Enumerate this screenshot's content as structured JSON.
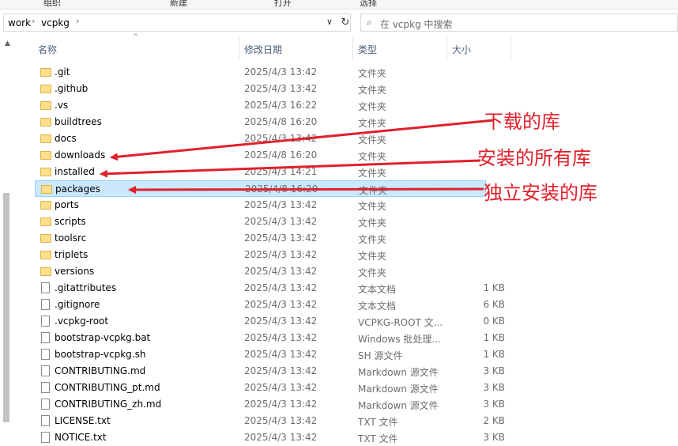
{
  "toolbar_labels": [
    "组织",
    "新建",
    "打开",
    "选择"
  ],
  "address": {
    "crumbs": [
      "work",
      "vcpkg"
    ]
  },
  "search": {
    "placeholder": "在 vcpkg 中搜索"
  },
  "columns": {
    "name": "名称",
    "date": "修改日期",
    "type": "类型",
    "size": "大小"
  },
  "files": [
    {
      "name": ".git",
      "date": "2025/4/3 13:42",
      "type": "文件夹",
      "size": "",
      "icon": "folder-icon"
    },
    {
      "name": ".github",
      "date": "2025/4/3 13:42",
      "type": "文件夹",
      "size": "",
      "icon": "folder-icon"
    },
    {
      "name": ".vs",
      "date": "2025/4/3 16:22",
      "type": "文件夹",
      "size": "",
      "icon": "folder-icon"
    },
    {
      "name": "buildtrees",
      "date": "2025/4/8 16:20",
      "type": "文件夹",
      "size": "",
      "icon": "folder-icon"
    },
    {
      "name": "docs",
      "date": "2025/4/3 13:42",
      "type": "文件夹",
      "size": "",
      "icon": "folder-icon"
    },
    {
      "name": "downloads",
      "date": "2025/4/8 16:20",
      "type": "文件夹",
      "size": "",
      "icon": "folder-icon"
    },
    {
      "name": "installed",
      "date": "2025/4/3 14:21",
      "type": "文件夹",
      "size": "",
      "icon": "folder-icon"
    },
    {
      "name": "packages",
      "date": "2025/4/8 16:20",
      "type": "文件夹",
      "size": "",
      "icon": "folder-icon",
      "selected": true
    },
    {
      "name": "ports",
      "date": "2025/4/3 13:42",
      "type": "文件夹",
      "size": "",
      "icon": "folder-icon"
    },
    {
      "name": "scripts",
      "date": "2025/4/3 13:42",
      "type": "文件夹",
      "size": "",
      "icon": "folder-icon"
    },
    {
      "name": "toolsrc",
      "date": "2025/4/3 13:42",
      "type": "文件夹",
      "size": "",
      "icon": "folder-icon"
    },
    {
      "name": "triplets",
      "date": "2025/4/3 13:42",
      "type": "文件夹",
      "size": "",
      "icon": "folder-icon"
    },
    {
      "name": "versions",
      "date": "2025/4/3 13:42",
      "type": "文件夹",
      "size": "",
      "icon": "folder-icon"
    },
    {
      "name": ".gitattributes",
      "date": "2025/4/3 13:42",
      "type": "文本文档",
      "size": "1 KB",
      "icon": "text-file-icon"
    },
    {
      "name": ".gitignore",
      "date": "2025/4/3 13:42",
      "type": "文本文档",
      "size": "6 KB",
      "icon": "text-file-icon"
    },
    {
      "name": ".vcpkg-root",
      "date": "2025/4/3 13:42",
      "type": "VCPKG-ROOT 文...",
      "size": "0 KB",
      "icon": "file-icon"
    },
    {
      "name": "bootstrap-vcpkg.bat",
      "date": "2025/4/3 13:42",
      "type": "Windows 批处理...",
      "size": "1 KB",
      "icon": "batch-file-icon"
    },
    {
      "name": "bootstrap-vcpkg.sh",
      "date": "2025/4/3 13:42",
      "type": "SH 源文件",
      "size": "1 KB",
      "icon": "script-file-icon"
    },
    {
      "name": "CONTRIBUTING.md",
      "date": "2025/4/3 13:42",
      "type": "Markdown 源文件",
      "size": "3 KB",
      "icon": "markdown-file-icon"
    },
    {
      "name": "CONTRIBUTING_pt.md",
      "date": "2025/4/3 13:42",
      "type": "Markdown 源文件",
      "size": "3 KB",
      "icon": "markdown-file-icon"
    },
    {
      "name": "CONTRIBUTING_zh.md",
      "date": "2025/4/3 13:42",
      "type": "Markdown 源文件",
      "size": "3 KB",
      "icon": "markdown-file-icon"
    },
    {
      "name": "LICENSE.txt",
      "date": "2025/4/3 13:42",
      "type": "TXT 文件",
      "size": "2 KB",
      "icon": "text-file-icon"
    },
    {
      "name": "NOTICE.txt",
      "date": "2025/4/3 13:42",
      "type": "TXT 文件",
      "size": "3 KB",
      "icon": "text-file-icon"
    }
  ],
  "annotations": {
    "downloads": "下载的库",
    "installed": "安装的所有库",
    "packages": "独立安装的库",
    "color": "#e0212b"
  }
}
